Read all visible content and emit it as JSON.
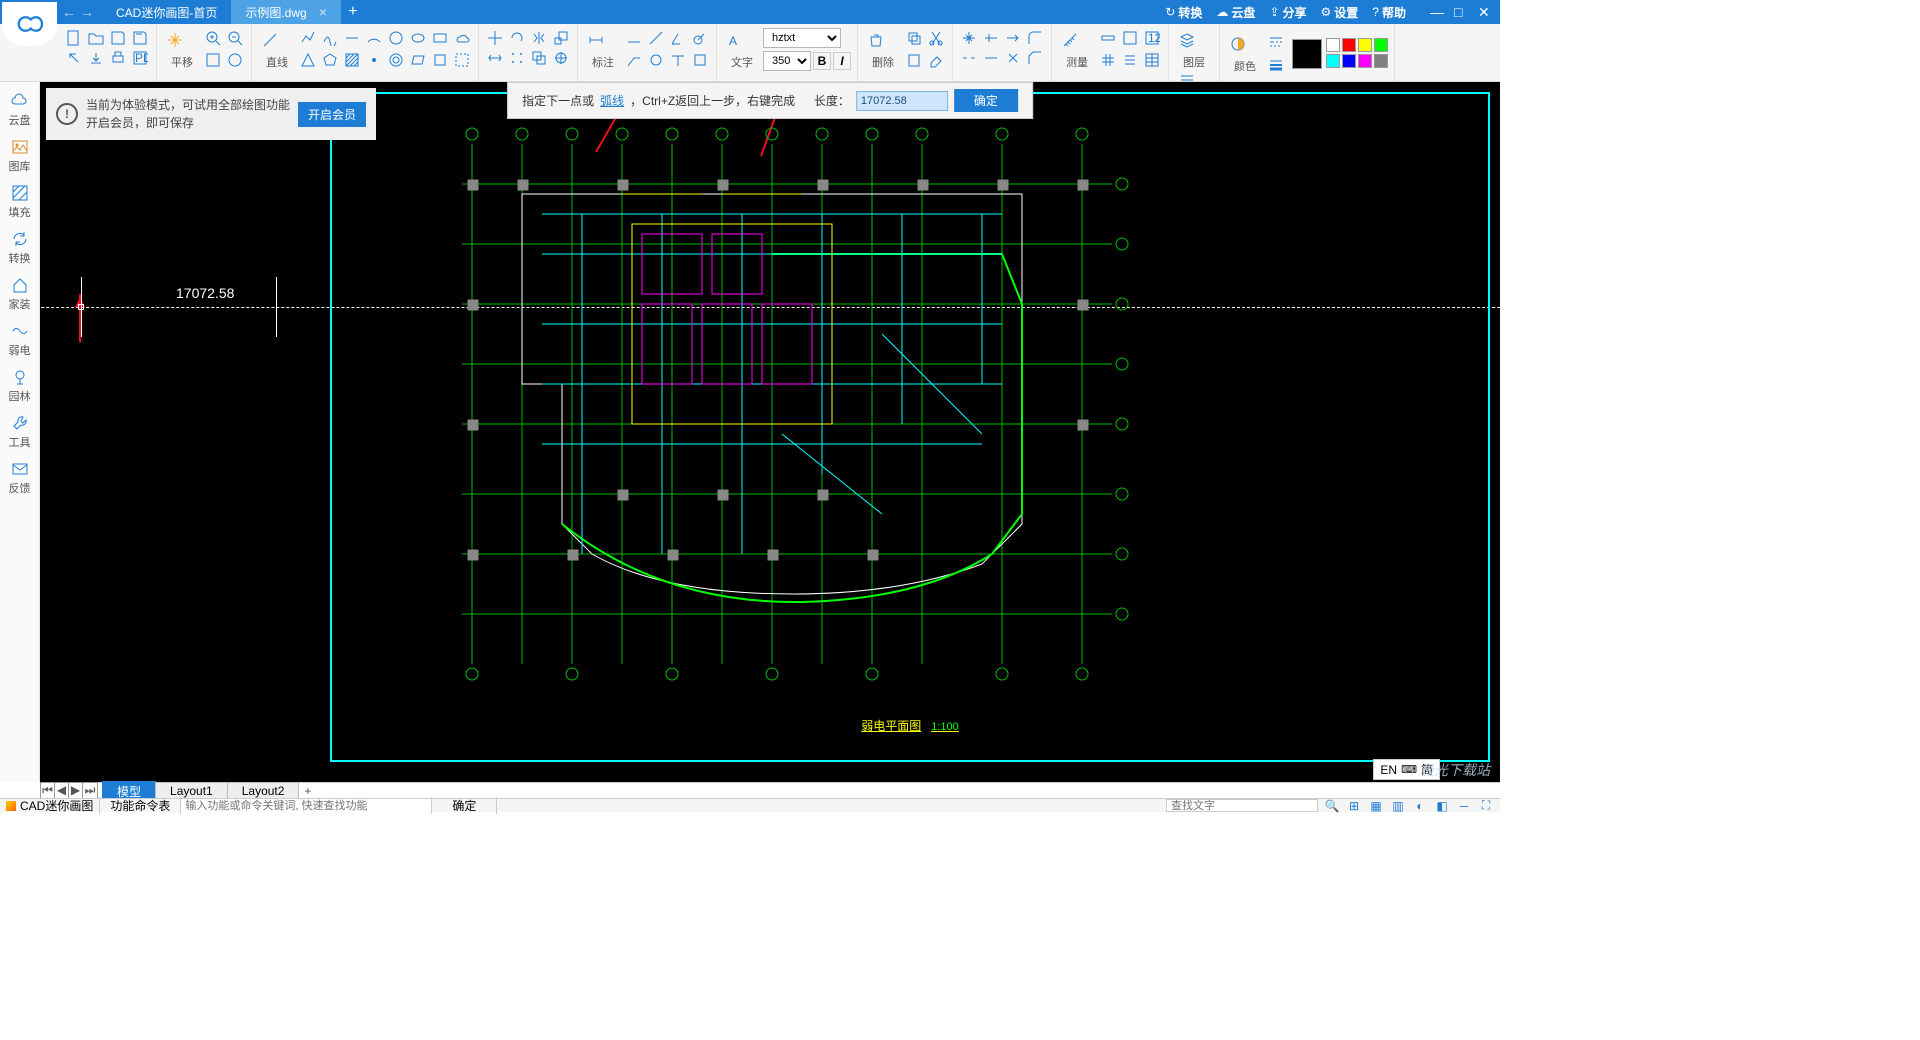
{
  "title": {
    "tab1": "CAD迷你画图-首页",
    "tab2": "示例图.dwg"
  },
  "titleright": {
    "convert": "转换",
    "cloud": "云盘",
    "share": "分享",
    "settings": "设置",
    "help": "帮助"
  },
  "ribbon": {
    "pan": "平移",
    "line": "直线",
    "anno": "标注",
    "text": "文字",
    "del": "删除",
    "meas": "测量",
    "layer": "图层",
    "color": "颜色",
    "font": "hztxt",
    "size": "350",
    "bold": "B",
    "italic": "I"
  },
  "colors": {
    "big": "#000000",
    "p": [
      "#ffffff",
      "#ff0000",
      "#ffff00",
      "#00ff00",
      "#00ffff",
      "#0000ff",
      "#ff00ff",
      "#808080"
    ]
  },
  "sidebar": [
    "云盘",
    "图库",
    "填充",
    "转换",
    "家装",
    "弱电",
    "园林",
    "工具",
    "反馈"
  ],
  "trial": {
    "l1": "当前为体验模式，可试用全部绘图功能",
    "l2": "开启会员，即可保存",
    "btn": "开启会员"
  },
  "cmd": {
    "t1": "指定下一点或",
    "link": "弧线",
    "t2": "，Ctrl+Z返回上一步，右键完成",
    "lenlab": "长度：",
    "len": "17072.58",
    "ok": "确定"
  },
  "canvas": {
    "len": "17072.58"
  },
  "plan": {
    "title": "弱电平面图",
    "scale": "1:100"
  },
  "btabs": {
    "model": "模型",
    "l1": "Layout1",
    "l2": "Layout2"
  },
  "status": {
    "app": "CAD迷你画图",
    "cmdtable": "功能命令表",
    "hint": "输入功能或命令关键词, 快速查找功能",
    "ok": "确定",
    "find": "查找文字"
  },
  "lang": {
    "en": "EN",
    "mode": "简"
  },
  "watermark": "极光下载站"
}
